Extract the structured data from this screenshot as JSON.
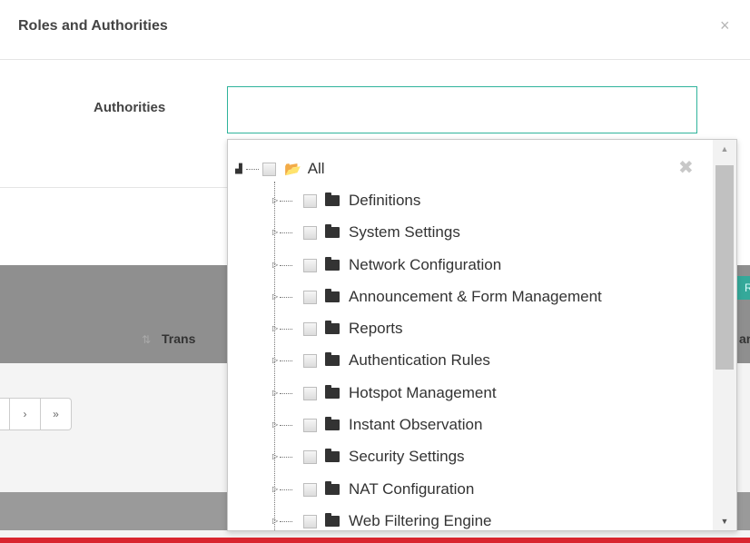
{
  "modal": {
    "title": "Roles and Authorities",
    "close_glyph": "×"
  },
  "form": {
    "label": "Authorities",
    "input_value": "",
    "accent_color": "#2fb39b"
  },
  "background": {
    "column_header": "Trans",
    "column_header_right": "an",
    "teal_edge_text": "R",
    "pager": [
      "",
      "›",
      "»"
    ]
  },
  "tree": {
    "close_glyph": "✖",
    "root": {
      "label": "All",
      "icon": "folder-open-icon"
    },
    "items": [
      {
        "label": "Definitions"
      },
      {
        "label": "System Settings"
      },
      {
        "label": "Network Configuration"
      },
      {
        "label": "Announcement & Form Management"
      },
      {
        "label": "Reports"
      },
      {
        "label": "Authentication Rules"
      },
      {
        "label": "Hotspot Management"
      },
      {
        "label": "Instant Observation"
      },
      {
        "label": "Security Settings"
      },
      {
        "label": "NAT Configuration"
      },
      {
        "label": "Web Filtering Engine"
      }
    ]
  },
  "scroll": {
    "up": "▲",
    "down": "▼"
  }
}
